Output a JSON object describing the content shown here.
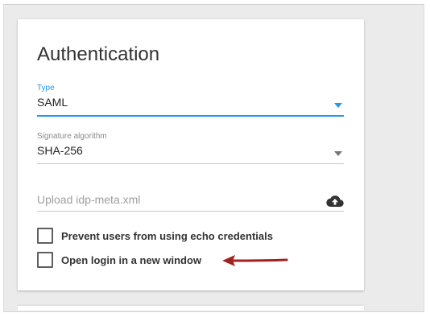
{
  "card": {
    "title": "Authentication"
  },
  "type_field": {
    "label": "Type",
    "value": "SAML",
    "dropdown_icon": "dropdown-arrow-icon",
    "accent_color": "#2196f3"
  },
  "signature_field": {
    "label": "Signature algorithm",
    "value": "SHA-256",
    "dropdown_icon": "dropdown-arrow-icon"
  },
  "upload_field": {
    "placeholder": "Upload idp-meta.xml",
    "icon": "cloud-upload-icon"
  },
  "checkboxes": [
    {
      "label": "Prevent users from using echo credentials",
      "checked": false
    },
    {
      "label": "Open login in a new window",
      "checked": false
    }
  ],
  "annotation": {
    "icon": "red-arrow-icon",
    "color": "#a32020"
  }
}
